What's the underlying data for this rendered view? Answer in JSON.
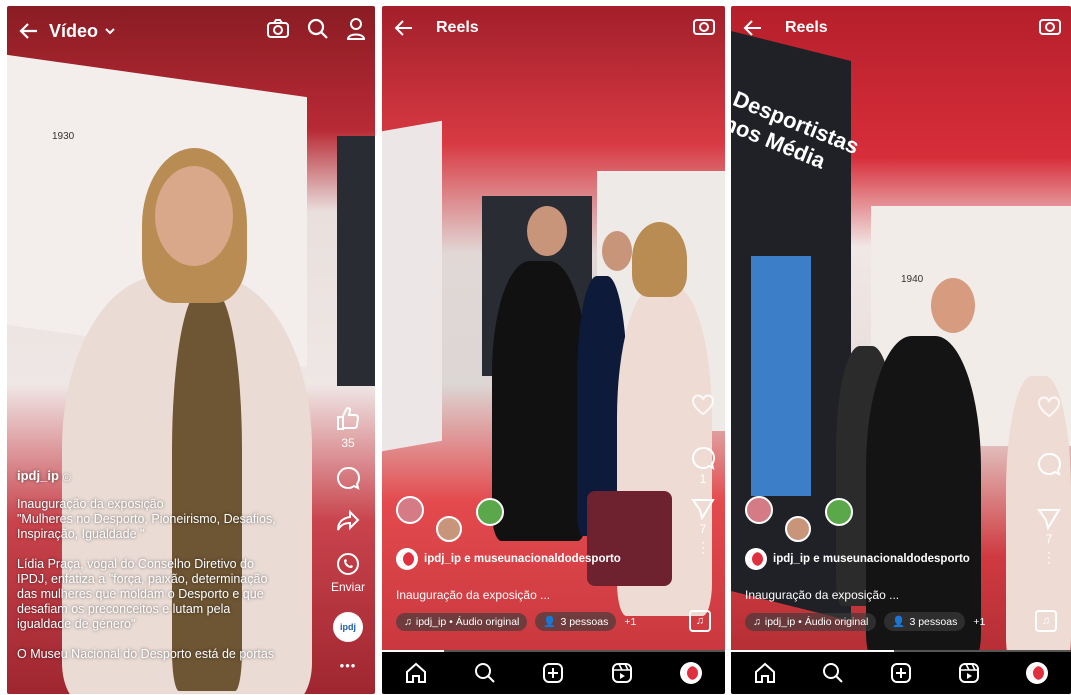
{
  "panel1": {
    "title": "Vídeo",
    "likes": "35",
    "username": "ipdj_ip",
    "caption_lines": [
      "Inauguração da exposição",
      "\"Mulheres no Desporto, Pioneirismo, Desafios,",
      "Inspiração, Igualdade \"",
      "",
      "Lídia Praça, vogal do Conselho Diretivo do",
      "IPDJ,  enfatiza a \"força, paixão, determinação",
      "das mulheres que moldam o Desporto e que",
      "desafiam os preconceitos e lutam pela",
      "igualdade de género\"",
      "",
      "O Museu Nacional do Desporto está de portas"
    ],
    "send_label": "Enviar",
    "more_label": "•••",
    "wall_year": "1930"
  },
  "panel2": {
    "title": "Reels",
    "users": "ipdj_ip e museunacionaldodesporto",
    "caption": "Inauguração da exposição ...",
    "audio": "ipdj_ip • Áudio original",
    "people": "3 pessoas",
    "plus": "+1",
    "comments": "1",
    "shares": "7"
  },
  "panel3": {
    "title": "Reels",
    "users": "ipdj_ip e museunacionaldodesporto",
    "caption": "Inauguração da exposição ...",
    "audio": "ipdj_ip • Áudio original",
    "people": "3 pessoas",
    "plus": "+1",
    "shares": "7",
    "wall_text": "Desportistas nos Média",
    "wall_year": "1940"
  },
  "colors": {
    "accent_red": "#e03040",
    "nav_bg": "#000000"
  }
}
